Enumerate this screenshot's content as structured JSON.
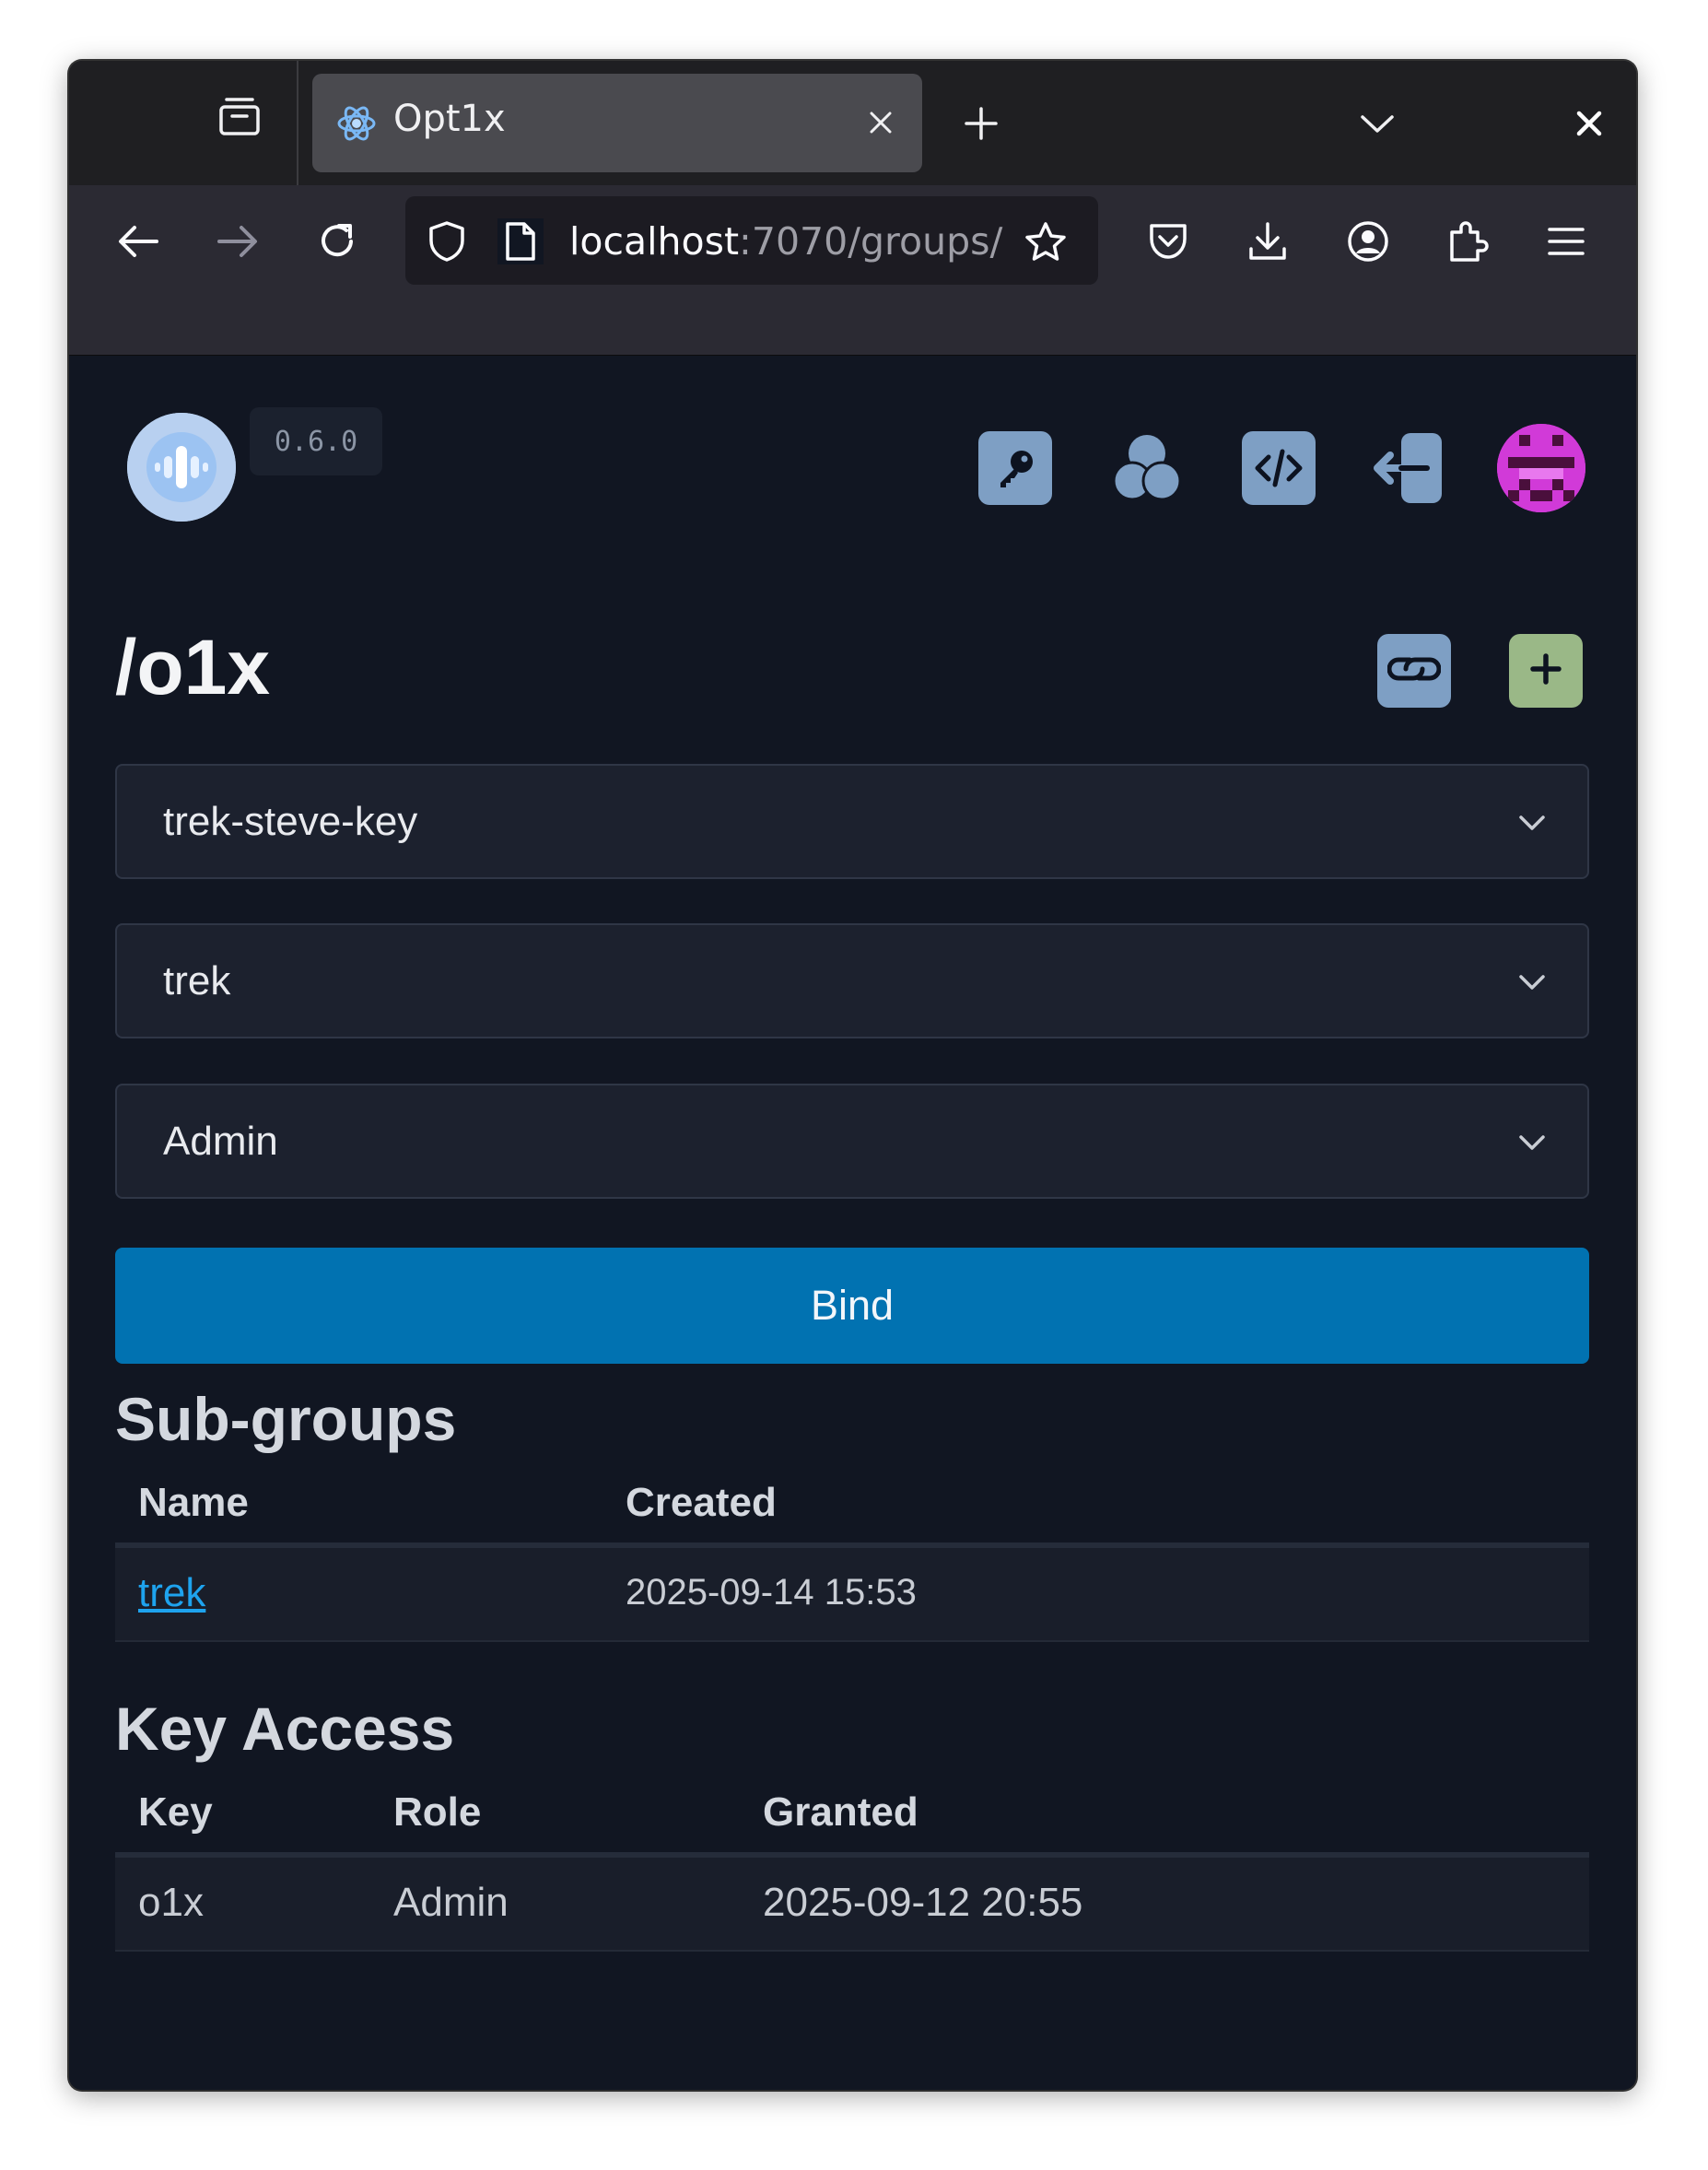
{
  "browser": {
    "tab_title": "Opt1x",
    "url_host": "localhost",
    "url_path": ":7070/groups/",
    "colors": {
      "tab_bar": "#1f1f22",
      "nav_bar": "#2b2a33",
      "active_tab": "#4a4a4f",
      "url_field": "#1c1b22"
    }
  },
  "header": {
    "version": "0.6.0",
    "nav_icons": [
      "key-icon",
      "groups-icon",
      "code-icon",
      "logout-icon"
    ],
    "avatar_icon": "avatar-icon"
  },
  "group": {
    "title": "/o1x",
    "actions": [
      "link-icon",
      "plus-icon"
    ]
  },
  "form": {
    "key_select": "trek-steve-key",
    "group_select": "trek",
    "role_select": "Admin",
    "bind_label": "Bind"
  },
  "subgroups": {
    "heading": "Sub-groups",
    "columns": [
      "Name",
      "Created"
    ],
    "rows": [
      {
        "name": "trek",
        "created": "2025-09-14 15:53"
      }
    ]
  },
  "key_access": {
    "heading": "Key Access",
    "columns": [
      "Key",
      "Role",
      "Granted"
    ],
    "rows": [
      {
        "key": "o1x",
        "role": "Admin",
        "granted": "2025-09-12 20:55"
      }
    ]
  },
  "colors": {
    "page_bg": "#111622",
    "accent_button": "#0172b1",
    "icon_button": "#7e9fc4",
    "add_button": "#9ab887",
    "link": "#1ea3ee",
    "avatar": "#d13ad8"
  }
}
